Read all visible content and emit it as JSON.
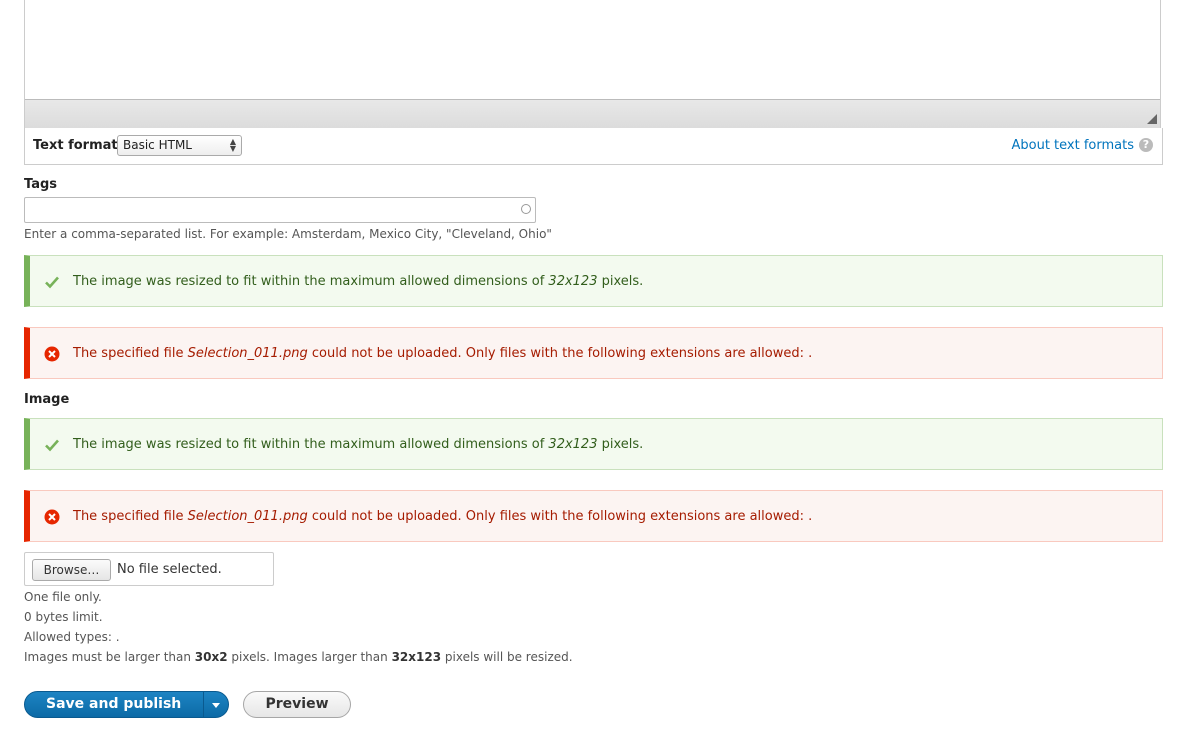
{
  "text_format": {
    "label": "Text format",
    "selected": "Basic HTML",
    "about_link": "About text formats",
    "help_glyph": "?"
  },
  "tags": {
    "label": "Tags",
    "value": "",
    "description": "Enter a comma-separated list. For example: Amsterdam, Mexico City, \"Cleveland, Ohio\""
  },
  "messages_tags": {
    "status": {
      "before": "The image was resized to fit within the maximum allowed dimensions of ",
      "dimensions": "32x123",
      "after": " pixels."
    },
    "error": {
      "before": "The specified file ",
      "filename": "Selection_011.png",
      "after": " could not be uploaded. Only files with the following extensions are allowed: ."
    }
  },
  "image": {
    "label": "Image",
    "status": {
      "before": "The image was resized to fit within the maximum allowed dimensions of ",
      "dimensions": "32x123",
      "after": " pixels."
    },
    "error": {
      "before": "The specified file ",
      "filename": "Selection_011.png",
      "after": " could not be uploaded. Only files with the following extensions are allowed: ."
    },
    "browse_label": "Browse…",
    "no_file": "No file selected.",
    "help": {
      "one_file": "One file only.",
      "limit": "0 bytes limit.",
      "allowed": "Allowed types: .",
      "dims_prefix": "Images must be larger than ",
      "min_dims": "30x2",
      "dims_middle": " pixels. Images larger than ",
      "max_dims": "32x123",
      "dims_suffix": " pixels will be resized."
    }
  },
  "actions": {
    "save_publish": "Save and publish",
    "preview": "Preview"
  },
  "icons": {
    "status": "check-icon",
    "error": "error-circle-icon",
    "help": "help-icon",
    "autocomplete": "throbber-icon",
    "dropdown": "chevron-down-icon"
  },
  "colors": {
    "status_accent": "#77b259",
    "error_accent": "#e62600",
    "primary_button": "#0c6aa6",
    "link": "#0074bd"
  }
}
